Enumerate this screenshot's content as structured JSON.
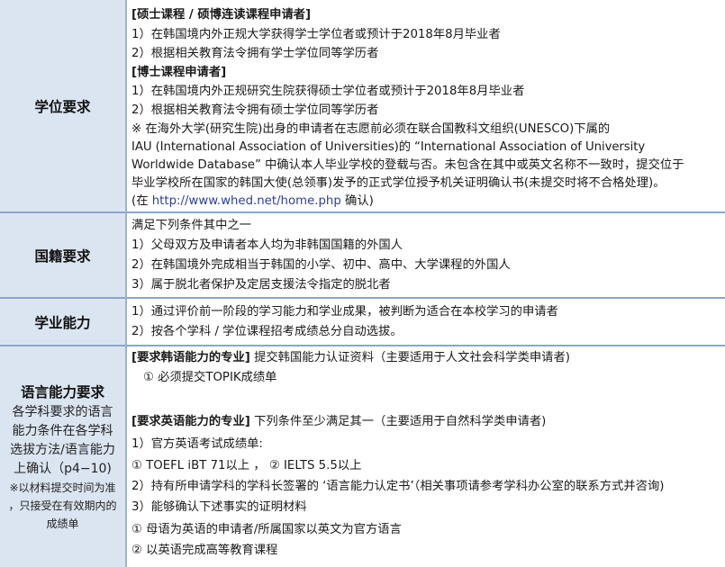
{
  "degree": {
    "header": "学位要求",
    "lines": [
      {
        "text": "[硕士课程 / 硕博连读课程申请者]",
        "bold": true
      },
      {
        "text": "1）在韩国境内外正规大学获得学士学位者或预计于2018年8月毕业者"
      },
      {
        "text": "2）根据相关教育法令拥有学士学位同等学历者"
      },
      {
        "text": "[博士课程申请者]",
        "bold": true
      },
      {
        "text": "1）在韩国境内外正规研究生院获得硕士学位者或预计于2018年8月毕业者"
      },
      {
        "text": "2）根据相关教育法令拥有硕士学位同等学历者"
      },
      {
        "text": "※ 在海外大学(研究生院)出身的申请者在志愿前必须在联合国教科文组织(UNESCO)下属的"
      },
      {
        "text": "IAU  (International  Association  of  Universities)的 “International  Association  of  University"
      },
      {
        "text": "Worldwide  Database” 中确认本人毕业学校的登载与否。未包含在其中或英文名称不一致时，提交位于"
      },
      {
        "text": "毕业学校所在国家的韩国大使(总领事)发予的正式学位授予机关证明确认书(未提交时将不合格处理)。"
      }
    ],
    "link_prefix": "(在",
    "link": "http://www.whed.net/home.php",
    "link_suffix": "确认)"
  },
  "nationality": {
    "header": "国籍要求",
    "lines": [
      "满足下列条件其中之一",
      "1）父母双方及申请者本人均为非韩国国籍的外国人",
      "2）在韩国境外完成相当于韩国的小学、初中、高中、大学课程的外国人",
      "3）属于脱北者保护及定居支援法令指定的脱北者"
    ]
  },
  "academic": {
    "header": "学业能力",
    "lines": [
      "1）通过评价前一阶段的学习能力和学业成果，被判断为适合在本校学习的申请者",
      "2）按各个学科 / 学位课程招考成绩总分自动选拔。"
    ]
  },
  "language": {
    "header": "语言能力要求",
    "desc": [
      "各学科要求的语言",
      "能力条件在各学科",
      "选拔方法/语言能力",
      "上确认（p4−10)"
    ],
    "note": [
      "※以材料提交时间为准",
      "，只接受在有效期内的",
      "成绩单"
    ],
    "korean_title": "[要求韩语能力的专业]",
    "korean_rest": "提交韩国能力认证资料（主要适用于人文社会科学类申请者)",
    "korean_item": "①  必须提交TOPIK成绩单",
    "english_title": "[要求英语能力的专业]",
    "english_rest": "下列条件至少满足其一（主要适用于自然科学类申请者)",
    "english_lines": [
      "1）官方英语考试成绩单:",
      "   ①  TOEFL  iBT  71以上  ，  ②  IELTS  5.5以上",
      "2）持有所申请学科的学科长签署的 ‘语言能力认定书’（相关事项请参考学科办公室的联系方式并咨询)",
      "3）能够确认下述事实的证明材料",
      "   ①  母语为英语的申请者/所属国家以英文为官方语言",
      "   ②  以英语完成高等教育课程"
    ]
  }
}
